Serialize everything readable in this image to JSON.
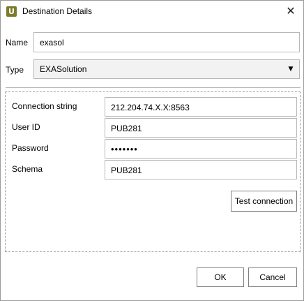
{
  "window": {
    "title": "Destination Details",
    "app_icon_letter": "U",
    "close_glyph": "✕"
  },
  "form": {
    "name_label": "Name",
    "name_value": "exasol",
    "type_label": "Type",
    "type_value": "EXASolution",
    "connection_string_label": "Connection string",
    "connection_string_value": "212.204.74.X.X:8563",
    "user_id_label": "User ID",
    "user_id_value": "PUB281",
    "password_label": "Password",
    "password_value": "•••••••",
    "schema_label": "Schema",
    "schema_value": "PUB281"
  },
  "buttons": {
    "test_connection": "Test connection",
    "ok": "OK",
    "cancel": "Cancel"
  },
  "icons": {
    "app": "uniserv-app-icon",
    "close": "close-icon",
    "dropdown": "chevron-down-icon"
  },
  "colors": {
    "app_icon": "#7d7a2a",
    "select_bg": "#f2f2f2"
  }
}
